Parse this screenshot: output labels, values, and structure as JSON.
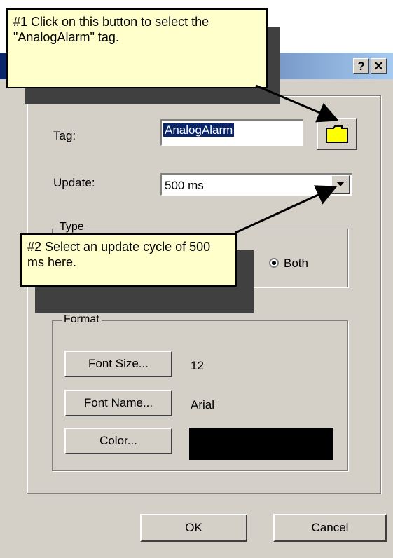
{
  "dialog": {
    "help_glyph": "?",
    "close_glyph": "✕"
  },
  "fields": {
    "tag_label": "Tag:",
    "tag_value": "AnalogAlarm",
    "update_label": "Update:",
    "update_value": "500 ms"
  },
  "type_group": {
    "title": "Type",
    "option_both": "Both"
  },
  "format_group": {
    "title": "Format",
    "font_size_button": "Font Size...",
    "font_size_value": "12",
    "font_name_button": "Font Name...",
    "font_name_value": "Arial",
    "color_button": "Color...",
    "color_value": "#000000"
  },
  "footer": {
    "ok_button": "OK",
    "cancel_button": "Cancel"
  },
  "callouts": {
    "first": "#1 Click on this button to select the \"AnalogAlarm\" tag.",
    "second": "#2 Select an update cycle of 500 ms here."
  },
  "colors": {
    "dialog_face": "#d4d0c8",
    "callout_bg": "#ffffcc",
    "selection": "#0a246a",
    "folder_icon": "#ffff00"
  }
}
